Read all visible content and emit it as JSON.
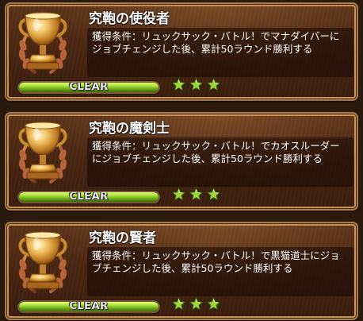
{
  "achievements": [
    {
      "title": "究鞄の使役者",
      "description": "獲得条件：リュックサック・バトル！でマナダイバーにジョブチェンジした後、累計50ラウンド勝利する",
      "progress": 1.0,
      "status_label": "CLEAR",
      "stars": 3
    },
    {
      "title": "究鞄の魔剣士",
      "description": "獲得条件：リュックサック・バトル！でカオスルーダーにジョブチェンジした後、累計50ラウンド勝利する",
      "progress": 1.0,
      "status_label": "CLEAR",
      "stars": 3
    },
    {
      "title": "究鞄の賢者",
      "description": "獲得条件：リュックサック・バトル！で黒猫道士にジョブチェンジした後、累計50ラウンド勝利する",
      "progress": 1.0,
      "status_label": "CLEAR",
      "stars": 3
    }
  ],
  "icons": {
    "trophy": "trophy-icon",
    "star": "star-icon"
  },
  "colors": {
    "star_green": "#9bd63a",
    "bar_green": "#8fcc2a",
    "card_brown": "#4a2712",
    "frame_gold": "#a97a45"
  }
}
